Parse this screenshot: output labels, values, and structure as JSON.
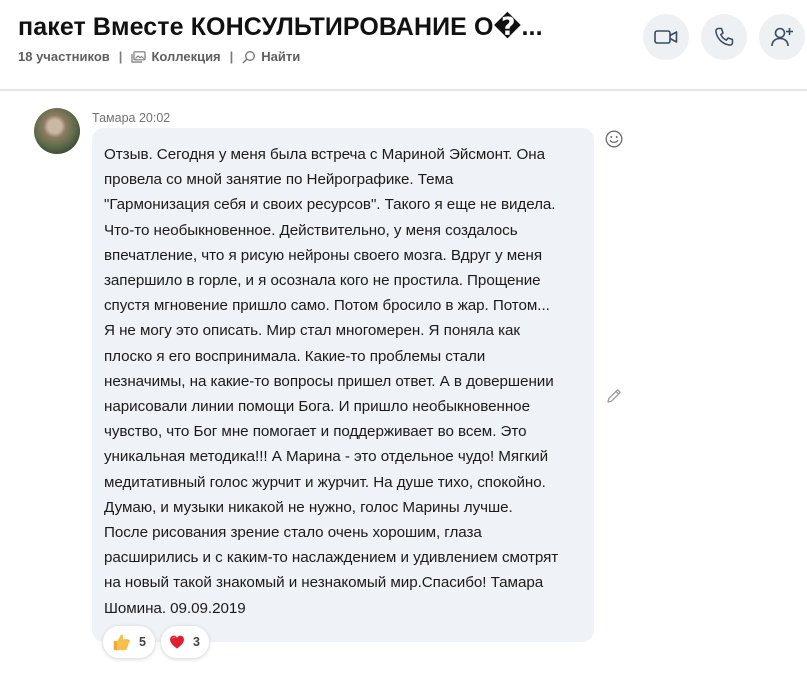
{
  "conversation": {
    "title": "пакет Вместе КОНСУЛЬТИРОВАНИЕ О�...",
    "participants": "18 участников",
    "collection_label": "Коллекция",
    "find_label": "Найти"
  },
  "message": {
    "sender_time": "Тамара 20:02",
    "lines": [
      "Отзыв. Сегодня у меня была встреча с Мариной Эйсмонт. Она",
      "провела со мной занятие по Нейрографике. Тема",
      "\"Гармонизация себя и своих ресурсов\". Такого я еще не видела.",
      "Что-то необыкновенное. Действительно, у меня создалось",
      "впечатление, что я рисую нейроны своего мозга. Вдруг у меня",
      "запершило в горле, и я осознала кого не простила. Прощение",
      "спустя мгновение пришло само. Потом бросило в жар. Потом...",
      "Я не могу это описать. Мир стал многомерен. Я поняла как",
      "плоско я его воспринимала. Какие-то проблемы стали",
      "незначимы, на какие-то вопросы пришел ответ. А в довершении",
      "нарисовали линии помощи Бога. И пришло необыкновенное",
      "чувство, что Бог мне помогает и поддерживает во всем. Это",
      "уникальная методика!!! А Марина - это отдельное чудо! Мягкий",
      "медитативный голос журчит и журчит. На душе тихо, спокойно.",
      "Думаю, и музыки никакой не нужно, голос Марины лучше.",
      "После рисования зрение стало очень хорошим, глаза",
      "расширились и с каким-то наслаждением и удивлением смотрят",
      "на новый такой знакомый и незнакомый мир.Спасибо! Тамара",
      "Шомина. 09.09.2019"
    ]
  },
  "reactions": [
    {
      "icon": "thumbs-up-icon",
      "count": "5"
    },
    {
      "icon": "heart-icon",
      "count": "3"
    }
  ],
  "colors": {
    "bubble": "#eff2f6",
    "accent_icon": "#3a4a5c",
    "heart": "#e0202f",
    "thumb": "#f6b93a"
  }
}
